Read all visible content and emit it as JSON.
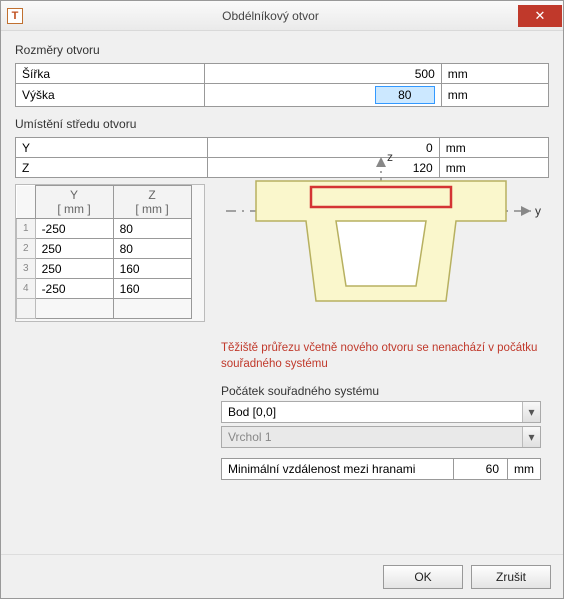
{
  "window": {
    "title": "Obdélníkový otvor",
    "app_icon_letter": "T"
  },
  "sections": {
    "dimensions_label": "Rozměry otvoru",
    "center_label": "Umístění středu otvoru"
  },
  "dimensions": {
    "width_label": "Šířka",
    "width_value": "500",
    "width_unit": "mm",
    "height_label": "Výška",
    "height_value": "80",
    "height_unit": "mm"
  },
  "center": {
    "y_label": "Y",
    "y_value": "0",
    "y_unit": "mm",
    "z_label": "Z",
    "z_value": "120",
    "z_unit": "mm"
  },
  "coord_table": {
    "header_y": "Y",
    "header_z": "Z",
    "unit_y": "[ mm ]",
    "unit_z": "[ mm ]",
    "rows": [
      {
        "n": "1",
        "y": "-250",
        "z": "80"
      },
      {
        "n": "2",
        "y": "250",
        "z": "80"
      },
      {
        "n": "3",
        "y": "250",
        "z": "160"
      },
      {
        "n": "4",
        "y": "-250",
        "z": "160"
      }
    ]
  },
  "diagram": {
    "axis_y": "y",
    "axis_z": "z"
  },
  "warning_text": "Těžiště průřezu včetně nového otvoru se nenachází v počátku souřadného systému",
  "origin": {
    "label": "Počátek souřadného systému",
    "combo_value": "Bod [0,0]",
    "vertex_value": "Vrchol 1"
  },
  "min_dist": {
    "label": "Minimální vzdálenost mezi hranami",
    "value": "60",
    "unit": "mm"
  },
  "buttons": {
    "ok": "OK",
    "cancel": "Zrušit"
  }
}
